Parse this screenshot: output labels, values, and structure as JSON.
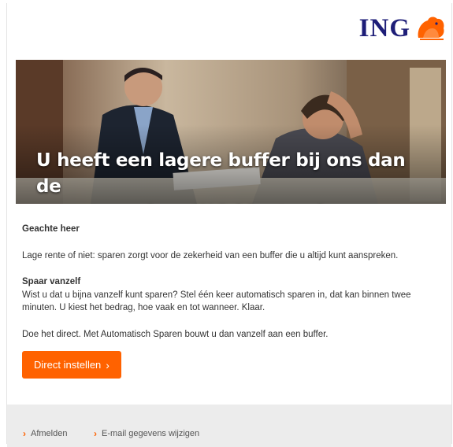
{
  "brand": {
    "logo_text": "ING",
    "accent": "#ff6200",
    "logo_color": "#1e1e78"
  },
  "hero": {
    "title": "U heeft een lagere buffer bij ons dan de\nmeeste andere ING-klanten in uw buurt"
  },
  "body": {
    "greeting": "Geachte heer",
    "intro": "Lage rente of niet: sparen zorgt voor de zekerheid van een buffer die u altijd kunt aanspreken.",
    "subheading": "Spaar vanzelf",
    "paragraph": "Wist u dat u bijna vanzelf kunt sparen? Stel één keer automatisch sparen in, dat kan binnen twee minuten. U kiest het bedrag, hoe vaak en tot wanneer. Klaar.",
    "closing": "Doe het direct. Met Automatisch Sparen bouwt u dan vanzelf aan een buffer."
  },
  "cta": {
    "label": "Direct instellen",
    "icon": "chevron-right-icon"
  },
  "footer": {
    "links": [
      {
        "label": "Afmelden",
        "icon": "chevron-right-icon"
      },
      {
        "label": "E-mail gegevens wijzigen",
        "icon": "chevron-right-icon"
      }
    ]
  }
}
